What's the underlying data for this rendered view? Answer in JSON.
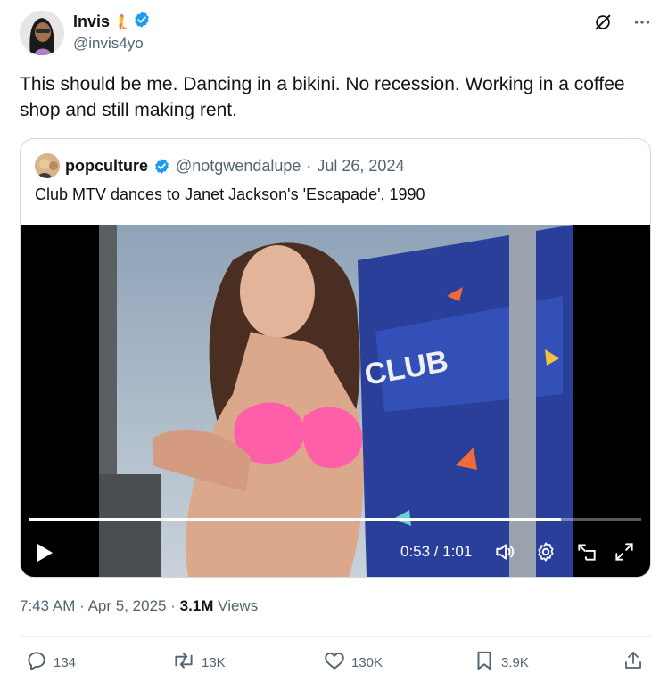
{
  "author": {
    "display_name": "Invis",
    "name_emoji": "🧜",
    "handle": "@invis4yo",
    "verified": true
  },
  "tweet": {
    "text": "This should be me. Dancing in a bikini. No recession. Working in a coffee shop and still making rent."
  },
  "quoted": {
    "display_name": "popculture",
    "handle": "@notgwendalupe",
    "separator": "·",
    "date": "Jul 26, 2024",
    "text": "Club MTV dances to Janet Jackson's 'Escapade', 1990",
    "video": {
      "timecode": "0:53 / 1:01",
      "progress": 0.869
    }
  },
  "meta": {
    "time": "7:43 AM",
    "sep1": "·",
    "date": "Apr 5, 2025",
    "sep2": "·",
    "views_count": "3.1M",
    "views_label": "Views"
  },
  "actions": {
    "replies": "134",
    "reposts": "13K",
    "likes": "130K",
    "bookmarks": "3.9K"
  },
  "colors": {
    "verified": "#1d9bf0",
    "text": "#0f1419",
    "secondary": "#536471"
  },
  "icons": [
    "grok-icon",
    "more-icon",
    "verified-badge-icon",
    "play-icon",
    "volume-icon",
    "settings-icon",
    "pip-icon",
    "fullscreen-icon",
    "reply-icon",
    "repost-icon",
    "like-icon",
    "bookmark-icon",
    "share-icon"
  ]
}
